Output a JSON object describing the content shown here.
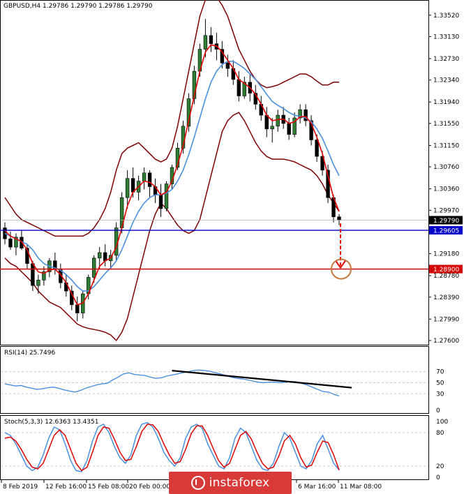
{
  "chart_data": [
    {
      "panel": "price",
      "type": "candlestick",
      "title": "GBPUSD,H4  1.29786 1.29790 1.29786 1.29790",
      "symbol": "GBPUSD",
      "timeframe": "H4",
      "y_ticks": [
        "1.33520",
        "1.33130",
        "1.32730",
        "1.32340",
        "1.31940",
        "1.31550",
        "1.31150",
        "1.30760",
        "1.30360",
        "1.29970",
        "1.29180",
        "1.28780",
        "1.28390",
        "1.27990",
        "1.27600"
      ],
      "ylim": [
        1.276,
        1.3372
      ],
      "x_ticks": [
        "8 Feb 2019",
        "12 Feb 16:00",
        "15 Feb 08:00",
        "20 Feb 00:00",
        "6 Mar 16:00",
        "11 Mar 08:00"
      ],
      "current_price": {
        "label": "1.29790",
        "value": 1.2979
      },
      "levels": [
        {
          "label": "1.29605",
          "value": 1.29605,
          "color": "#0000c8"
        },
        {
          "label": "1.28900",
          "value": 1.289,
          "color": "#d40000"
        }
      ],
      "candles": [
        [
          1.2965,
          1.2975,
          1.2935,
          1.2945
        ],
        [
          1.2945,
          1.2958,
          1.2925,
          1.293
        ],
        [
          1.293,
          1.2955,
          1.2915,
          1.2948
        ],
        [
          1.2948,
          1.296,
          1.2925,
          1.2928
        ],
        [
          1.2928,
          1.2935,
          1.289,
          1.29
        ],
        [
          1.29,
          1.2905,
          1.285,
          1.286
        ],
        [
          1.286,
          1.288,
          1.2845,
          1.287
        ],
        [
          1.287,
          1.2895,
          1.286,
          1.2885
        ],
        [
          1.2885,
          1.291,
          1.2875,
          1.2905
        ],
        [
          1.2905,
          1.292,
          1.288,
          1.289
        ],
        [
          1.289,
          1.29,
          1.2855,
          1.2865
        ],
        [
          1.2865,
          1.288,
          1.284,
          1.285
        ],
        [
          1.285,
          1.286,
          1.2815,
          1.2825
        ],
        [
          1.2825,
          1.284,
          1.2795,
          1.281
        ],
        [
          1.281,
          1.285,
          1.28,
          1.2845
        ],
        [
          1.2845,
          1.288,
          1.2835,
          1.2875
        ],
        [
          1.2875,
          1.2915,
          1.2865,
          1.291
        ],
        [
          1.291,
          1.293,
          1.289,
          1.292
        ],
        [
          1.292,
          1.2935,
          1.2895,
          1.2905
        ],
        [
          1.2905,
          1.2925,
          1.289,
          1.2915
        ],
        [
          1.2915,
          1.2975,
          1.2905,
          1.2965
        ],
        [
          1.2965,
          1.303,
          1.2955,
          1.302
        ],
        [
          1.302,
          1.307,
          1.3,
          1.3055
        ],
        [
          1.3055,
          1.3075,
          1.302,
          1.303
        ],
        [
          1.303,
          1.306,
          1.3015,
          1.305
        ],
        [
          1.305,
          1.3075,
          1.3035,
          1.3065
        ],
        [
          1.3065,
          1.307,
          1.302,
          1.304
        ],
        [
          1.304,
          1.3055,
          1.301,
          1.3025
        ],
        [
          1.3025,
          1.3045,
          1.2985,
          1.3
        ],
        [
          1.3,
          1.305,
          1.2995,
          1.3045
        ],
        [
          1.3045,
          1.308,
          1.3035,
          1.3075
        ],
        [
          1.3075,
          1.312,
          1.307,
          1.311
        ],
        [
          1.311,
          1.316,
          1.31,
          1.315
        ],
        [
          1.315,
          1.321,
          1.314,
          1.32
        ],
        [
          1.32,
          1.326,
          1.319,
          1.325
        ],
        [
          1.325,
          1.33,
          1.324,
          1.329
        ],
        [
          1.329,
          1.3345,
          1.3275,
          1.3315
        ],
        [
          1.3315,
          1.333,
          1.3285,
          1.33
        ],
        [
          1.33,
          1.332,
          1.327,
          1.329
        ],
        [
          1.329,
          1.3305,
          1.3255,
          1.3265
        ],
        [
          1.3265,
          1.328,
          1.324,
          1.3255
        ],
        [
          1.3255,
          1.327,
          1.3225,
          1.3235
        ],
        [
          1.3235,
          1.325,
          1.3195,
          1.3205
        ],
        [
          1.3205,
          1.324,
          1.32,
          1.323
        ],
        [
          1.323,
          1.3245,
          1.3195,
          1.321
        ],
        [
          1.321,
          1.3225,
          1.318,
          1.319
        ],
        [
          1.319,
          1.3205,
          1.316,
          1.317
        ],
        [
          1.317,
          1.3185,
          1.313,
          1.3145
        ],
        [
          1.3145,
          1.3165,
          1.312,
          1.315
        ],
        [
          1.315,
          1.318,
          1.314,
          1.317
        ],
        [
          1.317,
          1.3185,
          1.3145,
          1.3155
        ],
        [
          1.3155,
          1.3165,
          1.3125,
          1.3135
        ],
        [
          1.3135,
          1.3175,
          1.313,
          1.3165
        ],
        [
          1.3165,
          1.319,
          1.3155,
          1.318
        ],
        [
          1.318,
          1.319,
          1.315,
          1.316
        ],
        [
          1.316,
          1.317,
          1.3115,
          1.3125
        ],
        [
          1.3125,
          1.3135,
          1.3085,
          1.3095
        ],
        [
          1.3095,
          1.3105,
          1.306,
          1.307
        ],
        [
          1.307,
          1.308,
          1.301,
          1.302
        ],
        [
          1.302,
          1.3025,
          1.2975,
          1.2985
        ],
        [
          1.2985,
          1.299,
          1.297,
          1.2979
        ]
      ],
      "ma_fast": [
        1.296,
        1.295,
        1.2945,
        1.294,
        1.2925,
        1.29,
        1.2885,
        1.2882,
        1.2888,
        1.289,
        1.288,
        1.2865,
        1.2845,
        1.2825,
        1.2828,
        1.2845,
        1.287,
        1.2895,
        1.2905,
        1.291,
        1.293,
        1.2965,
        1.3005,
        1.303,
        1.304,
        1.305,
        1.3048,
        1.304,
        1.3025,
        1.303,
        1.305,
        1.308,
        1.3115,
        1.316,
        1.3205,
        1.325,
        1.3285,
        1.3298,
        1.3296,
        1.3285,
        1.327,
        1.3255,
        1.3235,
        1.3228,
        1.322,
        1.3208,
        1.319,
        1.317,
        1.316,
        1.3162,
        1.3163,
        1.3155,
        1.3158,
        1.3167,
        1.3168,
        1.3155,
        1.313,
        1.31,
        1.306,
        1.302,
        1.2995
      ],
      "ma_slow": [
        1.2955,
        1.295,
        1.2945,
        1.294,
        1.2935,
        1.2925,
        1.291,
        1.29,
        1.2895,
        1.2892,
        1.2888,
        1.288,
        1.287,
        1.2858,
        1.285,
        1.285,
        1.2858,
        1.287,
        1.2882,
        1.2892,
        1.2905,
        1.2925,
        1.295,
        1.2975,
        1.2995,
        1.301,
        1.302,
        1.3025,
        1.3025,
        1.3028,
        1.3035,
        1.305,
        1.307,
        1.3098,
        1.313,
        1.3165,
        1.32,
        1.323,
        1.325,
        1.3262,
        1.3268,
        1.3268,
        1.3262,
        1.3255,
        1.3245,
        1.3235,
        1.3222,
        1.3208,
        1.3195,
        1.3188,
        1.3182,
        1.3175,
        1.317,
        1.3168,
        1.3165,
        1.3158,
        1.3145,
        1.3128,
        1.3105,
        1.308,
        1.306
      ],
      "bb_upper": [
        1.302,
        1.3005,
        1.299,
        1.298,
        1.2975,
        1.297,
        1.2965,
        1.296,
        1.2955,
        1.295,
        1.295,
        1.295,
        1.295,
        1.295,
        1.295,
        1.2955,
        1.2965,
        1.298,
        1.3,
        1.303,
        1.307,
        1.31,
        1.311,
        1.3115,
        1.312,
        1.311,
        1.31,
        1.309,
        1.3085,
        1.309,
        1.311,
        1.315,
        1.32,
        1.325,
        1.33,
        1.335,
        1.338,
        1.339,
        1.3385,
        1.337,
        1.335,
        1.332,
        1.329,
        1.327,
        1.325,
        1.3235,
        1.3225,
        1.322,
        1.3222,
        1.3225,
        1.323,
        1.3235,
        1.324,
        1.3245,
        1.3245,
        1.324,
        1.3232,
        1.3225,
        1.3225,
        1.323,
        1.323
      ],
      "bb_lower": [
        1.291,
        1.29,
        1.2895,
        1.2885,
        1.2875,
        1.2865,
        1.285,
        1.284,
        1.283,
        1.2825,
        1.282,
        1.281,
        1.28,
        1.279,
        1.2785,
        1.2782,
        1.278,
        1.2778,
        1.2775,
        1.277,
        1.276,
        1.2775,
        1.28,
        1.284,
        1.288,
        1.292,
        1.296,
        1.299,
        1.301,
        1.3,
        1.2985,
        1.297,
        1.296,
        1.2955,
        1.296,
        1.298,
        1.302,
        1.306,
        1.31,
        1.314,
        1.316,
        1.317,
        1.3175,
        1.316,
        1.314,
        1.312,
        1.3105,
        1.3095,
        1.309,
        1.309,
        1.309,
        1.3088,
        1.3085,
        1.308,
        1.3075,
        1.307,
        1.306,
        1.3045,
        1.3025,
        1.301,
        1.2995
      ],
      "annotation": {
        "from": 1.2973,
        "to": 1.289,
        "label": ""
      }
    },
    {
      "panel": "rsi",
      "type": "line",
      "title": "RSI(14) 25.7496",
      "ylim": [
        0,
        100
      ],
      "y_ticks": [
        "70",
        "50",
        "30",
        "0"
      ],
      "values": [
        48,
        46,
        44,
        45,
        42,
        40,
        38,
        39,
        41,
        42,
        40,
        37,
        35,
        33,
        36,
        40,
        43,
        46,
        48,
        49,
        55,
        60,
        66,
        68,
        65,
        64,
        63,
        60,
        58,
        59,
        62,
        64,
        66,
        68,
        70,
        72,
        73,
        72,
        71,
        68,
        66,
        63,
        60,
        58,
        57,
        55,
        53,
        51,
        50,
        51,
        51,
        50,
        51,
        52,
        52,
        49,
        46,
        42,
        38,
        34,
        33,
        29,
        26
      ],
      "trendline": {
        "start": 72,
        "end": 41,
        "label": ""
      }
    },
    {
      "panel": "stoch",
      "type": "line",
      "title": "Stoch(5,3,3) 12.6363 13.4351",
      "ylim": [
        0,
        100
      ],
      "y_ticks": [
        "100",
        "80",
        "20",
        "0"
      ],
      "series": [
        {
          "values": [
            80,
            75,
            60,
            40,
            20,
            12,
            18,
            40,
            70,
            90,
            85,
            60,
            30,
            12,
            10,
            30,
            65,
            90,
            95,
            80,
            55,
            35,
            25,
            40,
            75,
            95,
            98,
            90,
            70,
            45,
            30,
            20,
            35,
            70,
            90,
            95,
            88,
            60,
            40,
            20,
            15,
            35,
            70,
            88,
            80,
            55,
            30,
            15,
            12,
            25,
            55,
            80,
            70,
            45,
            20,
            15,
            30,
            60,
            75,
            50,
            25,
            13
          ]
        },
        {
          "values": [
            70,
            72,
            65,
            50,
            32,
            18,
            15,
            25,
            50,
            75,
            85,
            75,
            50,
            25,
            12,
            18,
            45,
            75,
            90,
            88,
            68,
            45,
            30,
            32,
            55,
            82,
            95,
            94,
            82,
            60,
            40,
            25,
            28,
            50,
            78,
            92,
            92,
            75,
            52,
            30,
            18,
            25,
            50,
            75,
            82,
            68,
            45,
            25,
            15,
            18,
            38,
            65,
            75,
            60,
            35,
            18,
            22,
            45,
            65,
            62,
            40,
            13
          ]
        }
      ]
    }
  ]
}
